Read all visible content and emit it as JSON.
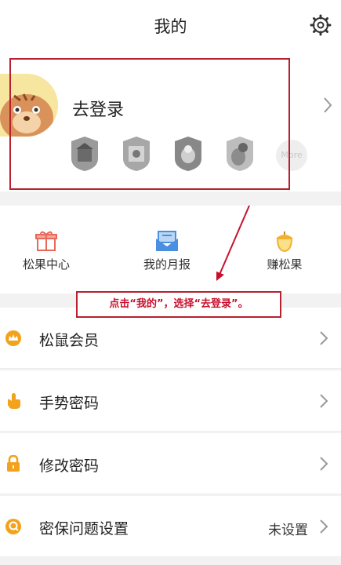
{
  "header": {
    "title": "我的",
    "settings_icon": "gear-icon"
  },
  "profile": {
    "login_label": "去登录",
    "badges": [
      "badge-icon-1",
      "badge-icon-2",
      "badge-icon-3",
      "badge-icon-4"
    ],
    "more_label": "More"
  },
  "quick_actions": [
    {
      "label": "松果中心",
      "icon": "gift-box-icon",
      "color": "#e8685a"
    },
    {
      "label": "我的月报",
      "icon": "mail-report-icon",
      "color": "#4a8fe0"
    },
    {
      "label": "赚松果",
      "icon": "acorn-icon",
      "color": "#f2b12c"
    }
  ],
  "menu": [
    {
      "label": "松鼠会员",
      "icon": "crown-icon",
      "value": ""
    },
    {
      "label": "手势密码",
      "icon": "hand-pointer-icon",
      "value": ""
    },
    {
      "label": "修改密码",
      "icon": "lock-icon",
      "value": ""
    },
    {
      "label": "密保问题设置",
      "icon": "security-question-icon",
      "value": "未设置"
    }
  ],
  "annotation": {
    "text": "点击“我的”，选择“去登录”。",
    "color": "#b7202e"
  },
  "colors": {
    "accent_orange": "#f2a21b"
  }
}
